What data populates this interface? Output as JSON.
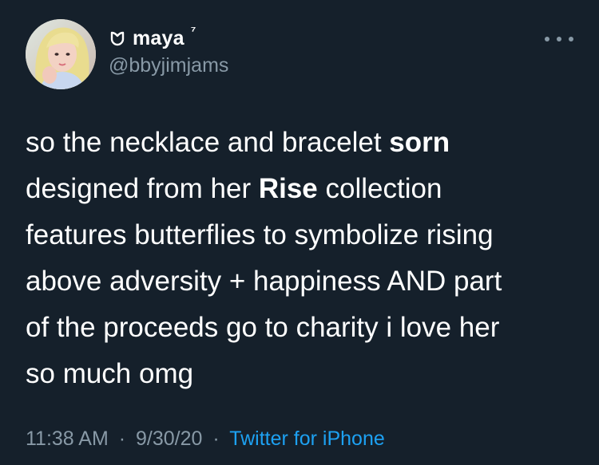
{
  "tweet": {
    "author": {
      "display_name": "maya",
      "name_suffix": "⁷",
      "handle": "@bbyjimjams",
      "name_icon": "heart-outline-icon",
      "avatar": "avatar"
    },
    "more_icon": "more-icon",
    "text_lines": [
      {
        "before": "so the necklace and bracelet ",
        "bold": "sorn",
        "after": ""
      },
      {
        "before": "designed from her ",
        "bold": "Rise",
        "after": " collection"
      },
      {
        "before": "features butterflies to symbolize rising",
        "bold": "",
        "after": ""
      },
      {
        "before": "above adversity + happiness AND part",
        "bold": "",
        "after": ""
      },
      {
        "before": "of the proceeds go to charity i love her",
        "bold": "",
        "after": ""
      },
      {
        "before": "so much omg",
        "bold": "",
        "after": ""
      }
    ],
    "meta": {
      "time": "11:38 AM",
      "separator": "·",
      "date": "9/30/20",
      "source": "Twitter for iPhone"
    },
    "colors": {
      "background": "#15202b",
      "text": "#ffffff",
      "secondary": "#8899a6",
      "link": "#1da1f2"
    }
  }
}
